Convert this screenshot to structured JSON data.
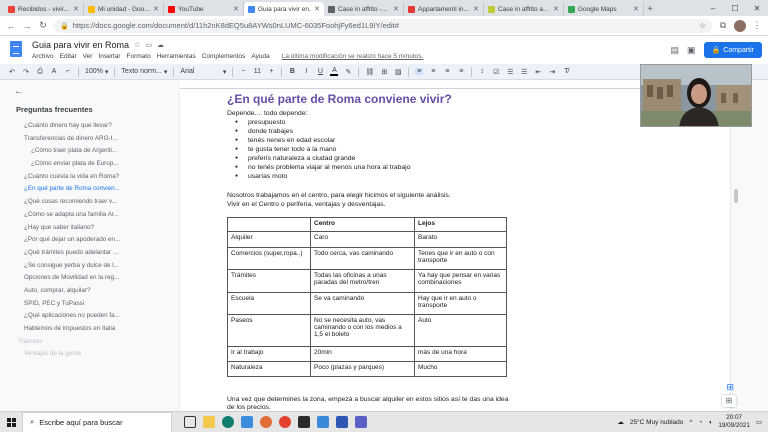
{
  "tabs": [
    {
      "title": "Recibidos - vivir...",
      "color": "#ea4335",
      "active": false
    },
    {
      "title": "Mi unidad - Goo...",
      "color": "#fbbc04",
      "active": false
    },
    {
      "title": "YouTube",
      "color": "#ff0000",
      "active": false
    },
    {
      "title": "Guia para vivir en...",
      "color": "#4285f4",
      "active": true
    },
    {
      "title": "Case in affitto -...",
      "color": "#5f6368",
      "active": false
    },
    {
      "title": "Appartamenti in...",
      "color": "#e53935",
      "active": false
    },
    {
      "title": "Case in affitto a...",
      "color": "#c0ca33",
      "active": false
    },
    {
      "title": "Google Maps",
      "color": "#34a853",
      "active": false
    }
  ],
  "address": {
    "url": "https://docs.google.com/document/d/11h2nK8dEQ5u8AYWs0nLUMC-6035FoohjFy6ed1L9IY/edit#"
  },
  "doc": {
    "title": "Guia para vivir en Roma",
    "menus": [
      "Archivo",
      "Editar",
      "Ver",
      "Insertar",
      "Formato",
      "Herramientas",
      "Complementos",
      "Ayuda"
    ],
    "last_edit": "La última modificación se realizó hace 5 minutos.",
    "share_label": "Compartir"
  },
  "toolbar": {
    "zoom": "100%",
    "style": "Texto norm...",
    "font": "Arial",
    "size": "11"
  },
  "outline": {
    "title": "Preguntas frecuentes",
    "items": [
      {
        "text": "¿Cuánto dinero hay que llevar?",
        "level": "l1"
      },
      {
        "text": "Transferencias de dinero ARG-I...",
        "level": "l1"
      },
      {
        "text": "¿Cómo traer plata de Argenti...",
        "level": "l2"
      },
      {
        "text": "¿Cómo enviar plata de Europ...",
        "level": "l2"
      },
      {
        "text": "¿Cuánto cuesta la vida en Roma?",
        "level": "l1"
      },
      {
        "text": "¿En qué parte de Roma convien...",
        "level": "l1",
        "active": true
      },
      {
        "text": "¿Qué cosas recomiendo traer v...",
        "level": "l1"
      },
      {
        "text": "¿Cómo se adapta una familia Ar...",
        "level": "l1"
      },
      {
        "text": "¿Hay que saber italiano?",
        "level": "l1"
      },
      {
        "text": "¿Por qué dejar un apoderado en...",
        "level": "l1"
      },
      {
        "text": "¿Qué trámites puedo adelantar ...",
        "level": "l1"
      },
      {
        "text": "¿Se consigue yerba y dulce de l...",
        "level": "l1"
      },
      {
        "text": "Opciones de Movilidad en la reg...",
        "level": "l1"
      },
      {
        "text": "Auto, comprar, alquilar?",
        "level": "l1"
      },
      {
        "text": "SPID, PEC y TuPassi",
        "level": "l1"
      },
      {
        "text": "¿Qué aplicaciones no pueden fa...",
        "level": "l1"
      },
      {
        "text": "Hablemos de impuestos en Italia",
        "level": "l1"
      },
      {
        "text": "Trámites",
        "level": "l0",
        "dim": true
      },
      {
        "text": "Ventajas de la gente",
        "level": "l1",
        "dim": true
      }
    ]
  },
  "content": {
    "heading": "¿En qué parte de Roma conviene vivir?",
    "intro": "Depende.... todo depende:",
    "bullets": [
      "presupuesto",
      "donde trabajes",
      "tenés nenes en edad escolar",
      "te gusta tener todo a la mano",
      "preferís naturaleza a ciudad grande",
      "no tenés problema viajar al menos una hora al trabajo",
      "usarías moto"
    ],
    "para1": "Nosotros trabajamos en el centro, para elegir hicimos el siguiente análisis.",
    "para2": "Vivir en el Centro o periferia, ventajas y desventajas.",
    "table": {
      "headers": [
        "",
        "Centro",
        "Lejos"
      ],
      "rows": [
        [
          "Alquiler",
          "Caro",
          "Barato"
        ],
        [
          "Comercios (super,ropa..)",
          "Todo cerca, vas caminando",
          "Tenes que ir en auto o con transporte"
        ],
        [
          "Trámites",
          "Todas las oficinas a unas paradas del metro/tren",
          "Ya hay que pensar en varias combinaciones"
        ],
        [
          "Escuela",
          "Se va caminando",
          "Hay que ir en auto o transporte"
        ],
        [
          "Paseos",
          "No se necesita auto, vas caminando o con los medios a 1,5 el boleto",
          "Auto"
        ],
        [
          "Ir al trabajo",
          "20min",
          "más de una hora"
        ],
        [
          "Naturaleza",
          "Poco (plazas y parques)",
          "Mucho"
        ]
      ]
    },
    "para3": "Una vez que determines la zona, empezá a buscar alquiler en estos sitios así te das una idea",
    "para4": "de los precios."
  },
  "taskbar": {
    "search_placeholder": "Escribe aquí para buscar",
    "weather": "25°C  Muy nublado",
    "time": "20:07",
    "date": "19/09/2021"
  }
}
